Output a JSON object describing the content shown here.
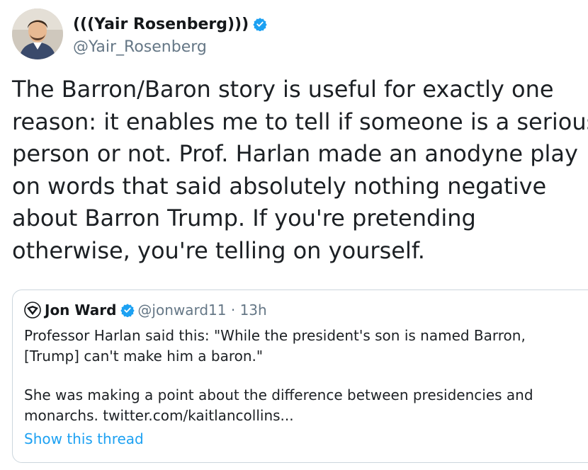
{
  "tweet": {
    "author": {
      "display_name": "(((Yair Rosenberg)))",
      "handle": "@Yair_Rosenberg",
      "verified": true
    },
    "text_lines": [
      "The Barron/Baron story is useful for exactly one",
      "reason: it enables me to tell if someone is a serious",
      "person or not. Prof. Harlan made an anodyne play",
      "on words that said absolutely nothing negative",
      "about Barron Trump. If you're pretending",
      "otherwise, you're telling on yourself."
    ]
  },
  "quoted_tweet": {
    "author_name": "Jon Ward",
    "verified": true,
    "handle_time": "@jonward11 · 13h",
    "body_paragraph_1": [
      "Professor Harlan said this: \"While the president's son is named Barron,",
      "[Trump] can't make him a baron.\""
    ],
    "body_paragraph_2": [
      "She was making a point about the difference between presidencies and",
      "monarchs. twitter.com/kaitlancollins..."
    ],
    "show_thread_label": "Show this thread"
  },
  "colors": {
    "verified_blue": "#1da1f2",
    "link_blue": "#1da1f2",
    "muted_gray": "#657786",
    "border": "#ccd6dd"
  },
  "icons": {
    "verified": "verified-badge-icon",
    "quote_author_logo": "logo-icon"
  }
}
